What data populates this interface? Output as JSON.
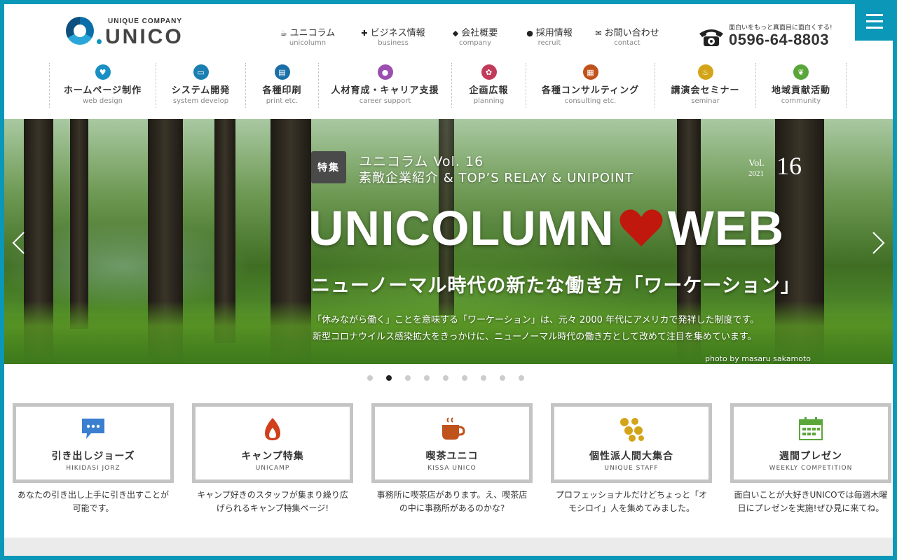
{
  "header": {
    "logo_sub": "UNIQUE COMPANY",
    "logo_main": "UNICO",
    "phone_tagline": "面白いをもっと真面目に面白くする!",
    "phone_number": "0596-64-8803"
  },
  "top_nav": [
    {
      "label": "ユニコラム",
      "en": "unicolumn",
      "icon": "coffee-icon"
    },
    {
      "label": "ビジネス情報",
      "en": "business",
      "icon": "plus-icon"
    },
    {
      "label": "会社概要",
      "en": "company",
      "icon": "tag-icon"
    },
    {
      "label": "採用情報",
      "en": "recruit",
      "icon": "person-icon"
    },
    {
      "label": "お問い合わせ",
      "en": "contact",
      "icon": "mail-icon"
    }
  ],
  "categories": [
    {
      "label": "ホームページ制作",
      "en": "web design",
      "color": "#1a8fc4",
      "icon": "heart-icon"
    },
    {
      "label": "システム開発",
      "en": "system develop",
      "color": "#1a7fb0",
      "icon": "monitor-icon"
    },
    {
      "label": "各種印刷",
      "en": "print etc.",
      "color": "#1a6fa8",
      "icon": "printer-icon"
    },
    {
      "label": "人材育成・キャリア支援",
      "en": "career support",
      "color": "#9b4fb0",
      "icon": "person-icon"
    },
    {
      "label": "企画広報",
      "en": "planning",
      "color": "#c23a5a",
      "icon": "flower-icon"
    },
    {
      "label": "各種コンサルティング",
      "en": "consulting etc.",
      "color": "#c0521c",
      "icon": "chart-icon"
    },
    {
      "label": "講演会セミナー",
      "en": "seminar",
      "color": "#d4a418",
      "icon": "flame-icon"
    },
    {
      "label": "地域貢献活動",
      "en": "community",
      "color": "#5aa63a",
      "icon": "leaf-icon"
    }
  ],
  "hero": {
    "tag": "特集",
    "series": "ユニコラム Vol. 16",
    "topics": "素敵企業紹介 & TOP’S RELAY & UNIPOINT",
    "vol_label": "Vol.",
    "vol_year": "2021",
    "vol_number": "16",
    "title_left": "UNICOLUMN",
    "title_right": "WEB",
    "subtitle": "ニューノーマル時代の新たな働き方「ワーケーション」",
    "desc_line1": "「休みながら働く」ことを意味する「ワーケーション」は、元々 2000 年代にアメリカで発祥した制度です。",
    "desc_line2": "新型コロナウイルス感染拡大をきっかけに、ニューノーマル時代の働き方として改めて注目を集めています。",
    "credit": "photo by masaru sakamoto",
    "heart_color": "#c0180c"
  },
  "slider": {
    "total": 9,
    "active_index": 1
  },
  "cards": [
    {
      "title": "引き出しジョーズ",
      "en": "HIKIDASI JORZ",
      "desc": "あなたの引き出し上手に引き出すことが可能です。",
      "icon": "chat-bubble-icon",
      "color": "#3a7fd0"
    },
    {
      "title": "キャンプ特集",
      "en": "UNICAMP",
      "desc": "キャンプ好きのスタッフが集まり繰り広げられるキャンプ特集ページ!",
      "icon": "fire-icon",
      "color": "#d0401a"
    },
    {
      "title": "喫茶ユニコ",
      "en": "KISSA UNICO",
      "desc": "事務所に喫茶店があります。え、喫茶店の中に事務所があるのかな?",
      "icon": "coffee-cup-icon",
      "color": "#c0521c"
    },
    {
      "title": "個性派人間大集合",
      "en": "UNIQUE STAFF",
      "desc": "プロフェッショナルだけどちょっと「オモシロイ」人を集めてみました。",
      "icon": "crowd-icon",
      "color": "#d4a418"
    },
    {
      "title": "週間プレゼン",
      "en": "WEEKLY COMPETITION",
      "desc": "面白いことが大好きUNICOでは毎週木曜日にプレゼンを実施!ぜひ見に来てね。",
      "icon": "calendar-icon",
      "color": "#5aa63a"
    }
  ]
}
